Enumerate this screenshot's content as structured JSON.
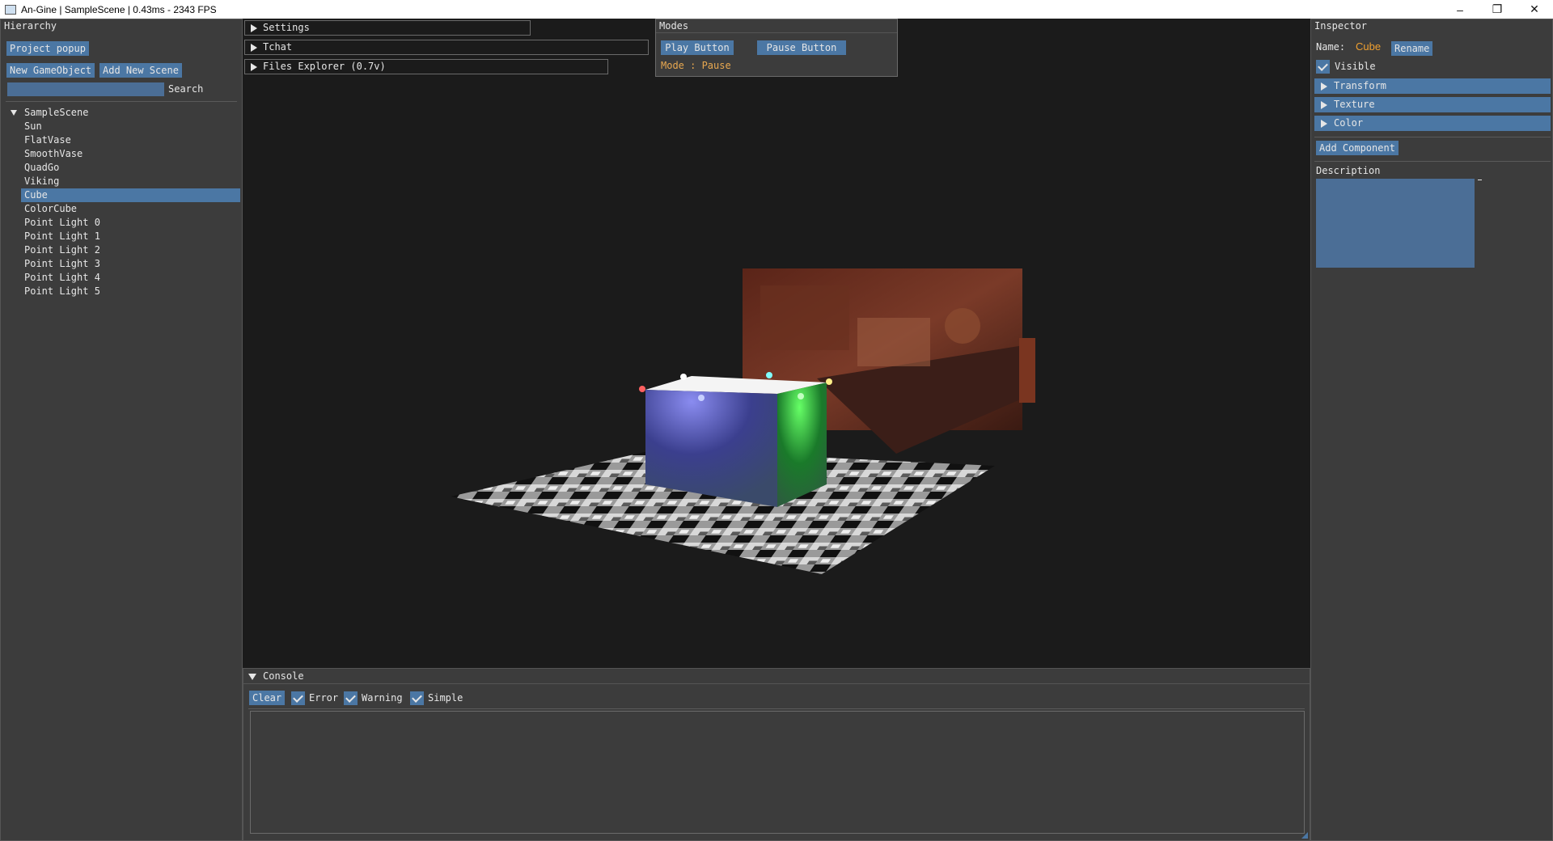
{
  "window": {
    "title": "An-Gine | SampleScene | 0.43ms - 2343 FPS",
    "minimize_icon": "–",
    "restore_icon": "❐",
    "close_icon": "✕"
  },
  "hierarchy": {
    "title": "Hierarchy",
    "project_popup": "Project popup",
    "new_gameobject": "New GameObject",
    "add_new_scene": "Add New Scene",
    "search_value": "",
    "search_label": "Search",
    "root": "SampleScene",
    "items": [
      "Sun",
      "FlatVase",
      "SmoothVase",
      "QuadGo",
      "Viking",
      "Cube",
      "ColorCube",
      "Point Light 0",
      "Point Light 1",
      "Point Light 2",
      "Point Light 3",
      "Point Light 4",
      "Point Light 5"
    ],
    "selected": "Cube"
  },
  "viewport": {
    "settings": "Settings",
    "tchat": "Tchat",
    "files_explorer": "Files Explorer (0.7v)"
  },
  "modes": {
    "title": "Modes",
    "play": "Play Button",
    "pause": "Pause Button",
    "status": "Mode : Pause"
  },
  "inspector": {
    "title": "Inspector",
    "name_label": "Name:",
    "name_value": "Cube",
    "rename": "Rename",
    "visible": "Visible",
    "visible_checked": true,
    "sections": [
      "Transform",
      "Texture",
      "Color"
    ],
    "add_component": "Add Component",
    "description_label": "Description",
    "description_value": ""
  },
  "console": {
    "title": "Console",
    "clear": "Clear",
    "filters": [
      {
        "label": "Error",
        "checked": true
      },
      {
        "label": "Warning",
        "checked": true
      },
      {
        "label": "Simple",
        "checked": true
      }
    ]
  },
  "colors": {
    "accent": "#4b77a4",
    "panel_bg": "#3c3c3c",
    "viewport_bg": "#1b1b1b",
    "highlight_text": "#f0a030"
  }
}
